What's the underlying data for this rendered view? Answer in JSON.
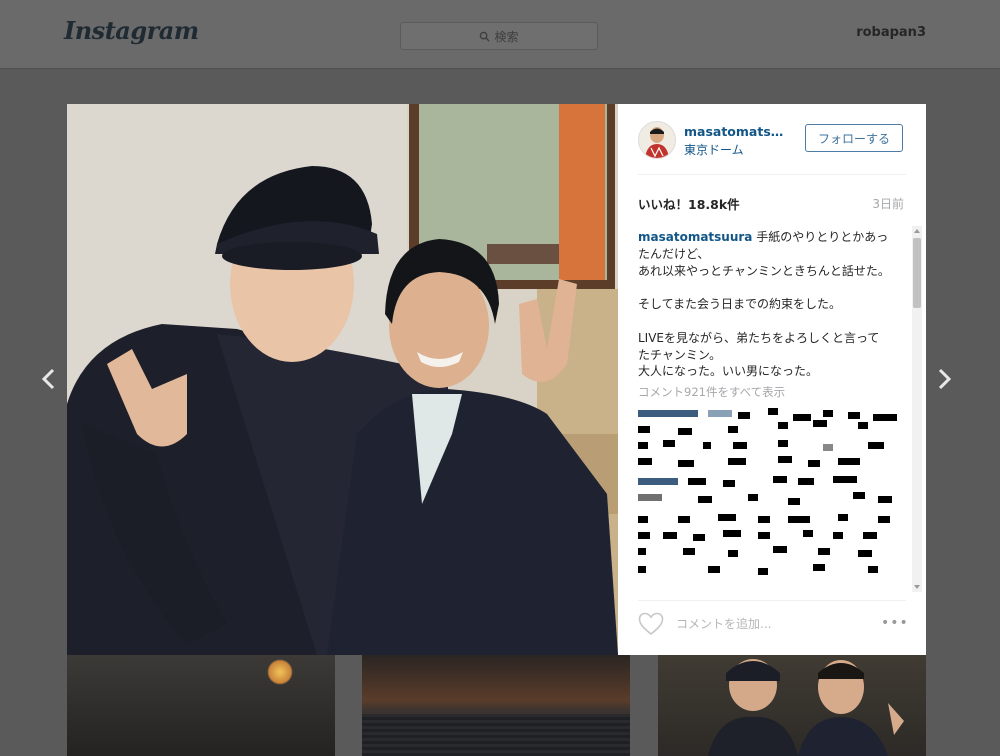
{
  "header": {
    "logo": "Instagram",
    "search_placeholder": "検索",
    "username": "robapan3"
  },
  "post": {
    "author": "masatomatsuu...",
    "location": "東京ドーム",
    "follow_label": "フォローする",
    "likes": "いいね！18.8k件",
    "time_ago": "3日前",
    "caption_user": "masatomatsuura",
    "caption_text": " 手紙のやりとりとかあったんだけど、\nあれ以来やっとチャンミンときちんと話せた。\n\nそしてまた会う日までの約束をした。\n\nLIVEを見ながら、弟たちをよろしくと言ってたチャンミン。\n大人になった。いい男になった。",
    "view_all_comments": "コメント921件をすべて表示",
    "comment_placeholder": "コメントを追加...",
    "more_label": "•••"
  },
  "icons": {
    "search": "search-icon",
    "heart": "heart-icon",
    "prev": "chevron-left-icon",
    "next": "chevron-right-icon"
  },
  "colors": {
    "link": "#125688",
    "follow": "#3f729b",
    "overlay": "#5a5a5a"
  }
}
